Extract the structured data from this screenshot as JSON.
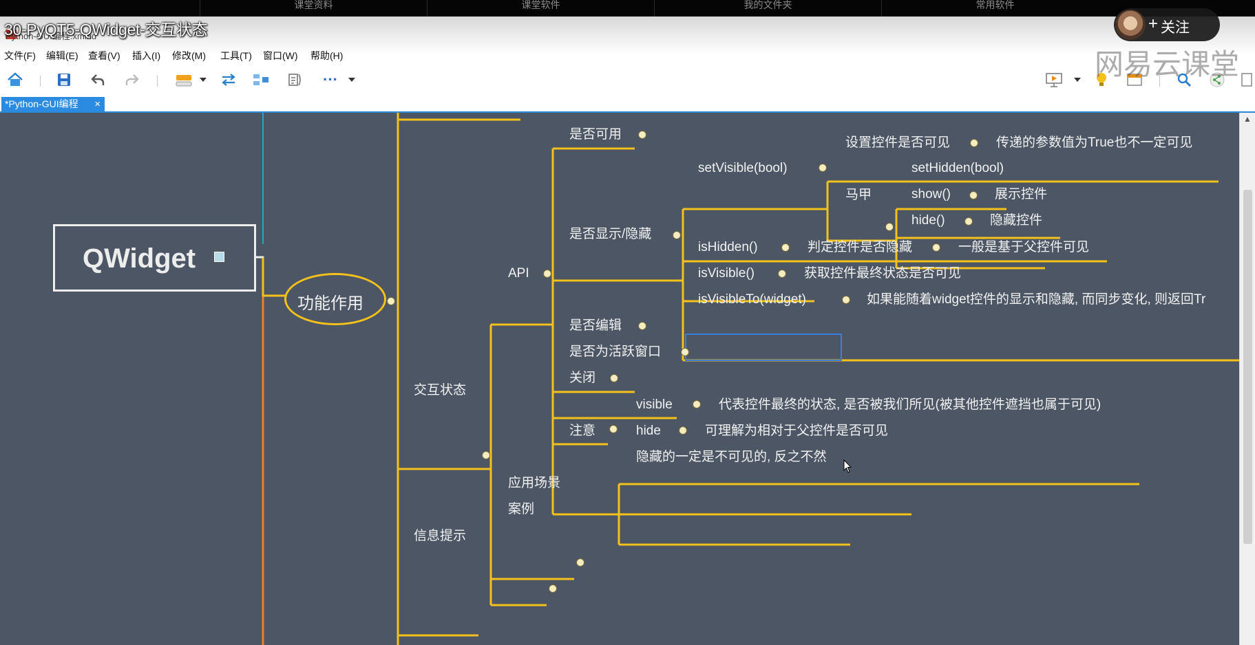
{
  "top_nav": [
    "课堂资料",
    "课堂软件",
    "我的文件夹",
    "常用软件"
  ],
  "video_title": "30-PyQT5-QWidget-交互状态",
  "window_title": "Python-GUI编程.xmind",
  "follow": {
    "label": "关注",
    "plus": "+"
  },
  "watermark": "网易云课堂",
  "menu": [
    "文件(F)",
    "编辑(E)",
    "查看(V)",
    "插入(I)",
    "修改(M)",
    "工具(T)",
    "窗口(W)",
    "帮助(H)"
  ],
  "toolbar": {
    "icons": [
      "home-icon",
      "save-icon",
      "undo-icon",
      "redo-icon",
      "topic-icon",
      "relationship-icon",
      "summary-icon",
      "boundary-icon",
      "more-icon",
      "presentation-icon",
      "bulb-icon",
      "panel-icon",
      "search-icon",
      "share-icon",
      "export-icon"
    ],
    "more_label": "···"
  },
  "tab": {
    "label": "*Python-GUI编程",
    "close": "×"
  },
  "mindmap": {
    "root": "QWidget",
    "feature": "功能作用",
    "interactive_state": "交互状态",
    "info_tip": "信息提示",
    "api": "API",
    "usage_scene": "应用场景",
    "example": "案例",
    "enabled": "是否可用",
    "show_hide": "是否显示/隐藏",
    "edit": "是否编辑",
    "active_window": "是否为活跃窗口",
    "close": "关闭",
    "note": "注意",
    "set_visible": "setVisible(bool)",
    "set_visible_desc": "设置控件是否可见",
    "set_visible_param": "传递的参数值为True也不一定可见",
    "vest": "马甲",
    "set_hidden": "setHidden(bool)",
    "show": "show()",
    "show_desc": "展示控件",
    "hide_fn": "hide()",
    "hide_desc": "隐藏控件",
    "is_hidden": "isHidden()",
    "is_hidden_desc": "判定控件是否隐藏",
    "is_hidden_note": "一般是基于父控件可见",
    "is_visible": "isVisible()",
    "is_visible_desc": "获取控件最终状态是否可见",
    "is_visible_to": "isVisibleTo(widget)",
    "is_visible_to_desc": "如果能随着widget控件的显示和隐藏, 而同步变化, 则返回Tr",
    "visible": "visible",
    "visible_desc": "代表控件最终的状态, 是否被我们所见(被其他控件遮挡也属于可见)",
    "hide": "hide",
    "hide_note_desc": "可理解为相对于父控件是否可见",
    "hidden_note": "隐藏的一定是不可见的, 反之不然"
  }
}
